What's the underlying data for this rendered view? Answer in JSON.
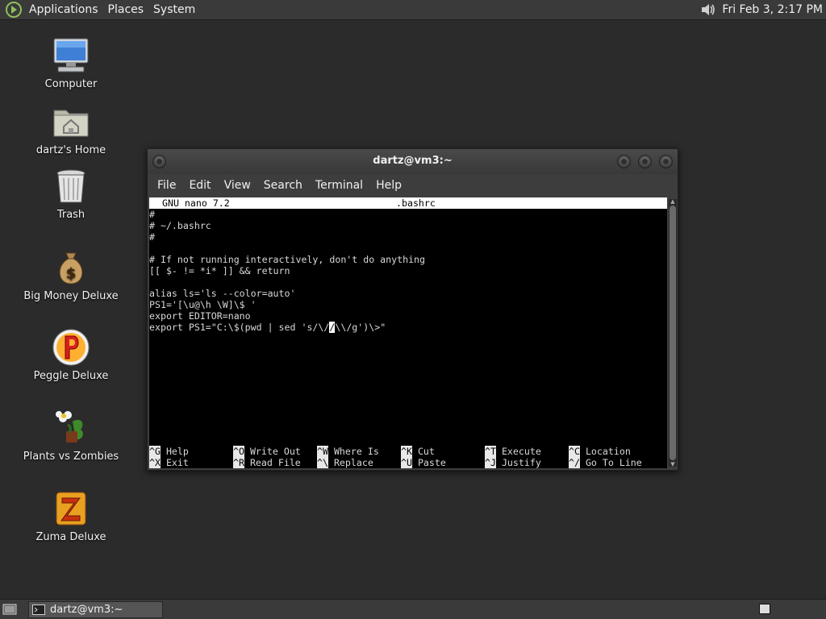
{
  "top_panel": {
    "menus": [
      "Applications",
      "Places",
      "System"
    ],
    "clock": "Fri Feb  3,  2:17 PM"
  },
  "desktop_icons": [
    {
      "label": "Computer",
      "icon": "computer-icon"
    },
    {
      "label": "dartz's Home",
      "icon": "home-folder-icon"
    },
    {
      "label": "Trash",
      "icon": "trash-icon"
    },
    {
      "label": "Big Money Deluxe",
      "icon": "money-bag-icon"
    },
    {
      "label": "Peggle Deluxe",
      "icon": "peggle-icon"
    },
    {
      "label": "Plants vs Zombies",
      "icon": "plants-vs-zombies-icon"
    },
    {
      "label": "Zuma Deluxe",
      "icon": "zuma-icon"
    }
  ],
  "terminal": {
    "title": "dartz@vm3:~",
    "menu": [
      "File",
      "Edit",
      "View",
      "Search",
      "Terminal",
      "Help"
    ],
    "nano": {
      "version": "GNU nano 7.2",
      "filename": ".bashrc",
      "lines": [
        "#",
        "# ~/.bashrc",
        "#",
        "",
        "# If not running interactively, don't do anything",
        "[[ $- != *i* ]] && return",
        "",
        "alias ls='ls --color=auto'",
        "PS1='[\\u@\\h \\W]\\$ '",
        "export EDITOR=nano"
      ],
      "cursor_line": {
        "before": "export PS1=\"C:\\$(pwd | sed 's/\\/",
        "cursor": "/",
        "after": "\\\\/g')\\>\""
      },
      "shortcuts_row1": [
        {
          "key": "^G",
          "label": "Help"
        },
        {
          "key": "^O",
          "label": "Write Out"
        },
        {
          "key": "^W",
          "label": "Where Is"
        },
        {
          "key": "^K",
          "label": "Cut"
        },
        {
          "key": "^T",
          "label": "Execute"
        },
        {
          "key": "^C",
          "label": "Location"
        }
      ],
      "shortcuts_row2": [
        {
          "key": "^X",
          "label": "Exit"
        },
        {
          "key": "^R",
          "label": "Read File"
        },
        {
          "key": "^\\",
          "label": "Replace"
        },
        {
          "key": "^U",
          "label": "Paste"
        },
        {
          "key": "^J",
          "label": "Justify"
        },
        {
          "key": "^/",
          "label": "Go To Line"
        }
      ]
    }
  },
  "taskbar": {
    "task_label": "dartz@vm3:~"
  }
}
